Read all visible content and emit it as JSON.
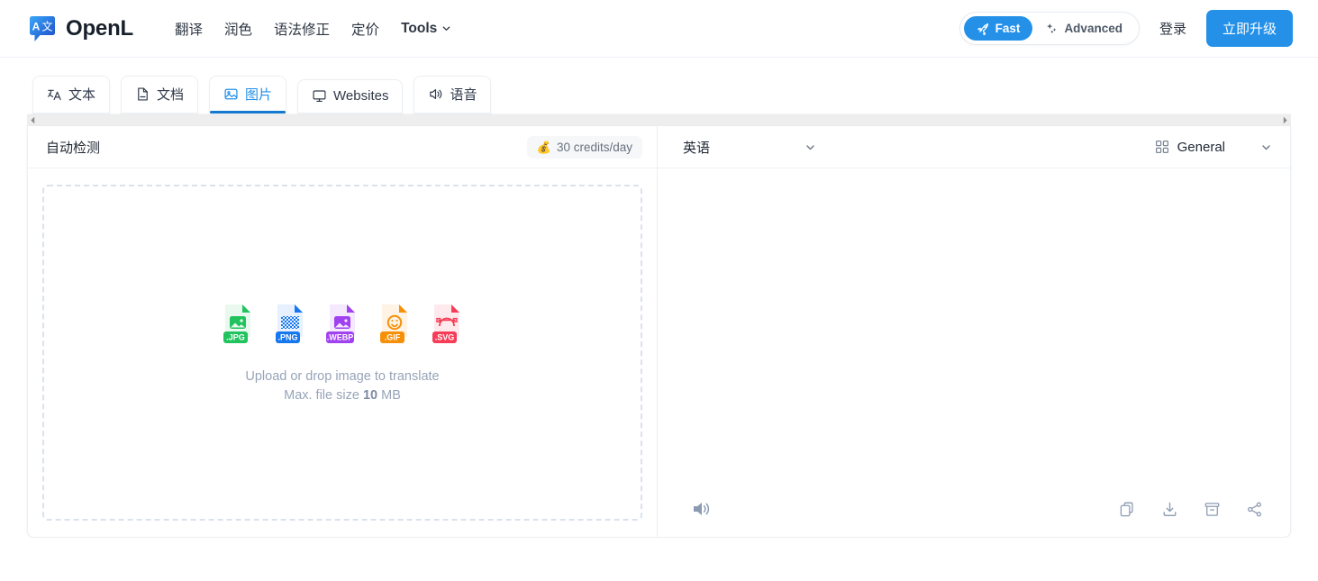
{
  "header": {
    "brand": {
      "name": "OpenL",
      "logo_icon": "translate-bubble-logo",
      "letter_a": "A",
      "letter_cjk": "文"
    },
    "nav": [
      {
        "label": "翻译",
        "name": "nav-translate"
      },
      {
        "label": "润色",
        "name": "nav-polish"
      },
      {
        "label": "语法修正",
        "name": "nav-grammar"
      },
      {
        "label": "定价",
        "name": "nav-pricing"
      },
      {
        "label": "Tools",
        "name": "nav-tools",
        "has_caret": true
      }
    ],
    "mode_toggle": {
      "fast": {
        "label": "Fast",
        "icon": "rocket-icon",
        "active": true
      },
      "advanced": {
        "label": "Advanced",
        "icon": "sparkles-icon",
        "active": false
      }
    },
    "login_label": "登录",
    "upgrade_label": "立即升级",
    "accent_color": "#2490e8"
  },
  "tabs": [
    {
      "label": "文本",
      "icon": "text-translate-icon",
      "active": false
    },
    {
      "label": "文档",
      "icon": "document-icon",
      "active": false
    },
    {
      "label": "图片",
      "icon": "image-icon",
      "active": true
    },
    {
      "label": "Websites",
      "icon": "monitor-icon",
      "active": false
    },
    {
      "label": "语音",
      "icon": "speaker-icon",
      "active": false
    }
  ],
  "source_panel": {
    "language": "自动检测",
    "credits_badge": {
      "icon": "money-bag-icon",
      "label": "30 credits/day"
    },
    "dropzone": {
      "line1": "Upload or drop image to translate",
      "line2_prefix": "Max. file size ",
      "line2_value": "10",
      "line2_suffix": " MB",
      "file_types": [
        {
          "ext": ".JPG",
          "color": "#22c35e",
          "tint": "#e9f9ef",
          "glyph": "image-icon"
        },
        {
          "ext": ".PNG",
          "color": "#1677ef",
          "tint": "#e6f0fe",
          "glyph": "checkerboard-icon"
        },
        {
          "ext": ".WEBP",
          "color": "#a042f0",
          "tint": "#f4e9fe",
          "glyph": "image-icon"
        },
        {
          "ext": ".GIF",
          "color": "#f79009",
          "tint": "#fef3e4",
          "glyph": "smiley-icon"
        },
        {
          "ext": ".SVG",
          "color": "#f63d57",
          "tint": "#feeaed",
          "glyph": "bezier-curve-icon"
        }
      ]
    }
  },
  "target_panel": {
    "language": "英语",
    "domain": {
      "label": "General",
      "icon": "grid-icon"
    },
    "output_text": "",
    "footer": {
      "speaker_icon": "speaker-icon",
      "actions": [
        {
          "name": "copy-icon",
          "title": "copy"
        },
        {
          "name": "download-icon",
          "title": "download"
        },
        {
          "name": "archive-icon",
          "title": "archive"
        },
        {
          "name": "share-icon",
          "title": "share"
        }
      ]
    }
  }
}
